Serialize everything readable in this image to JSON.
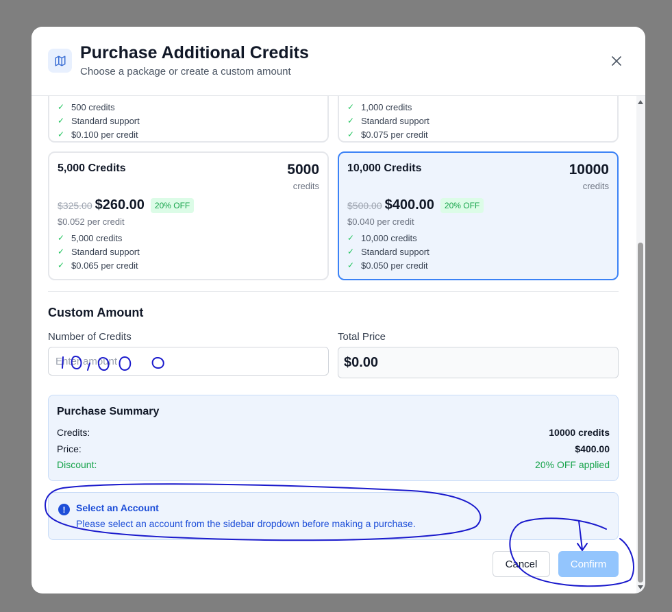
{
  "header": {
    "title": "Purchase Additional Credits",
    "subtitle": "Choose a package or create a custom amount"
  },
  "packages": [
    {
      "name": "",
      "amount": "",
      "unit": "",
      "old_price": "",
      "price": "",
      "badge": "",
      "per_credit": "",
      "features": [
        "500 credits",
        "Standard support",
        "$0.100 per credit"
      ],
      "selected": false
    },
    {
      "name": "",
      "amount": "",
      "unit": "",
      "old_price": "",
      "price": "",
      "badge": "",
      "per_credit": "",
      "features": [
        "1,000 credits",
        "Standard support",
        "$0.075 per credit"
      ],
      "selected": false
    },
    {
      "name": "5,000 Credits",
      "amount": "5000",
      "unit": "credits",
      "old_price": "$325.00",
      "price": "$260.00",
      "badge": "20% OFF",
      "per_credit": "$0.052 per credit",
      "features": [
        "5,000 credits",
        "Standard support",
        "$0.065 per credit"
      ],
      "selected": false
    },
    {
      "name": "10,000 Credits",
      "amount": "10000",
      "unit": "credits",
      "old_price": "$500.00",
      "price": "$400.00",
      "badge": "20% OFF",
      "per_credit": "$0.040 per credit",
      "features": [
        "10,000 credits",
        "Standard support",
        "$0.050 per credit"
      ],
      "selected": true
    }
  ],
  "custom": {
    "title": "Custom Amount",
    "credits_label": "Number of Credits",
    "credits_placeholder": "Enter amount",
    "credits_value": "",
    "total_label": "Total Price",
    "total_value": "$0.00"
  },
  "summary": {
    "title": "Purchase Summary",
    "credits_label": "Credits:",
    "credits_value": "10000 credits",
    "price_label": "Price:",
    "price_value": "$400.00",
    "discount_label": "Discount:",
    "discount_value": "20% OFF applied"
  },
  "alert": {
    "icon": "exclamation-icon",
    "title": "Select an Account",
    "message": "Please select an account from the sidebar dropdown before making a purchase."
  },
  "buttons": {
    "cancel": "Cancel",
    "confirm": "Confirm"
  },
  "colors": {
    "accent": "#3b82f6",
    "selected_bg": "#eef4fd",
    "discount_green": "#16a34a",
    "alert_blue": "#1d4ed8",
    "confirm_disabled": "#93c5fd",
    "annotation_ink": "#1a1acc"
  }
}
